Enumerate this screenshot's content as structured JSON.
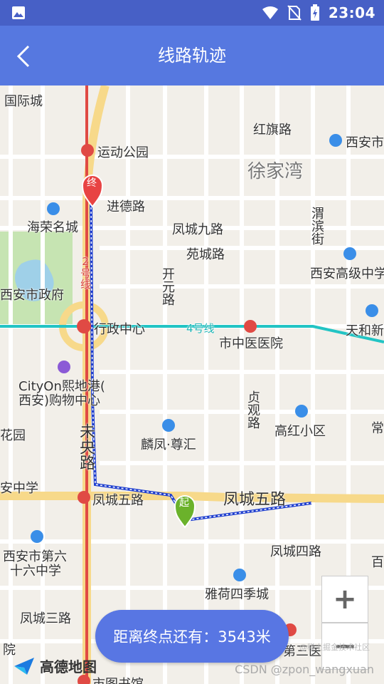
{
  "status_bar": {
    "time": "23:04"
  },
  "app_bar": {
    "title": "线路轨迹"
  },
  "map_labels": {
    "guojicheng": "国际城",
    "hongqilu": "红旗路",
    "xian_right": "西安市",
    "yundonggongyuan": "运动公园",
    "xujiawan": "徐家湾",
    "jindelu": "进德路",
    "haironghmingcheng": "海荣名城",
    "fengcheng9": "凤城九路",
    "weibinjie": "渭滨街",
    "yuanchenglu": "苑城路",
    "xianzhengfu": "西安市政府",
    "kaiyuanlu": "开元路",
    "xianhigh": "西安高级中学",
    "heping": "天和新",
    "xingzhengzhongxin": "行政中心",
    "line4": "4号线",
    "line2": "2号线",
    "shizhongyi": "市中医医院",
    "cityon": "CityOn熙地港(",
    "cityon2": "西安)购物中心",
    "zhenguanlu": "贞观路",
    "gaohong": "高红小区",
    "huayuan": "花园",
    "weiyanglu": "未央路",
    "linfeng": "麟凤·尊汇",
    "anzhongxue": "安中学",
    "fengcheng5_left": "凤城五路",
    "fengcheng5_big": "凤城五路",
    "xian6": "西安市第六",
    "xian6b": "十六中学",
    "fengcheng4": "凤城四路",
    "yahe": "雅荷四季城",
    "fengcheng3": "凤城三路",
    "diyuan": "院",
    "disan": "第三医院",
    "shitushuguan": "市图书馆",
    "chang": "常",
    "bai": "百"
  },
  "markers": {
    "start": "起",
    "end": "终"
  },
  "distance_bubble": "距离终点还有：3543米",
  "zoom": {
    "in": "+",
    "out": "−"
  },
  "logo": "高德地图",
  "watermark": "CSDN @zpon_wangxuan",
  "watermark_small": "@稀土掘金技术社区"
}
